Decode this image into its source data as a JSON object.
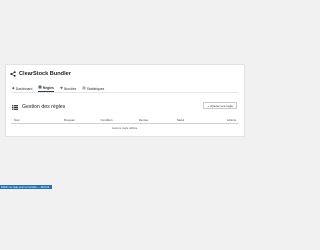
{
  "app": {
    "title": "ClearStock Bundler"
  },
  "tabs": [
    {
      "label": "Dashboard",
      "active": false,
      "icon": "dashboard-icon"
    },
    {
      "label": "Règles",
      "active": true,
      "icon": "rules-icon"
    },
    {
      "label": "Bundles",
      "active": false,
      "icon": "bundles-icon"
    },
    {
      "label": "Statistiques",
      "active": false,
      "icon": "stats-icon"
    }
  ],
  "section": {
    "title": "Gestion des règles",
    "add_button": "Ajouter une règle"
  },
  "table": {
    "headers": [
      "Nom",
      "Bouquet",
      "Condition",
      "Remise",
      "Statut",
      "Actions"
    ],
    "empty_text": "Aucune règle définie."
  },
  "status_bar": {
    "text": "Définir une règle pour les bundles — 2024-06"
  },
  "colors": {
    "accent": "#2271b1",
    "background": "#f1f1f1"
  }
}
